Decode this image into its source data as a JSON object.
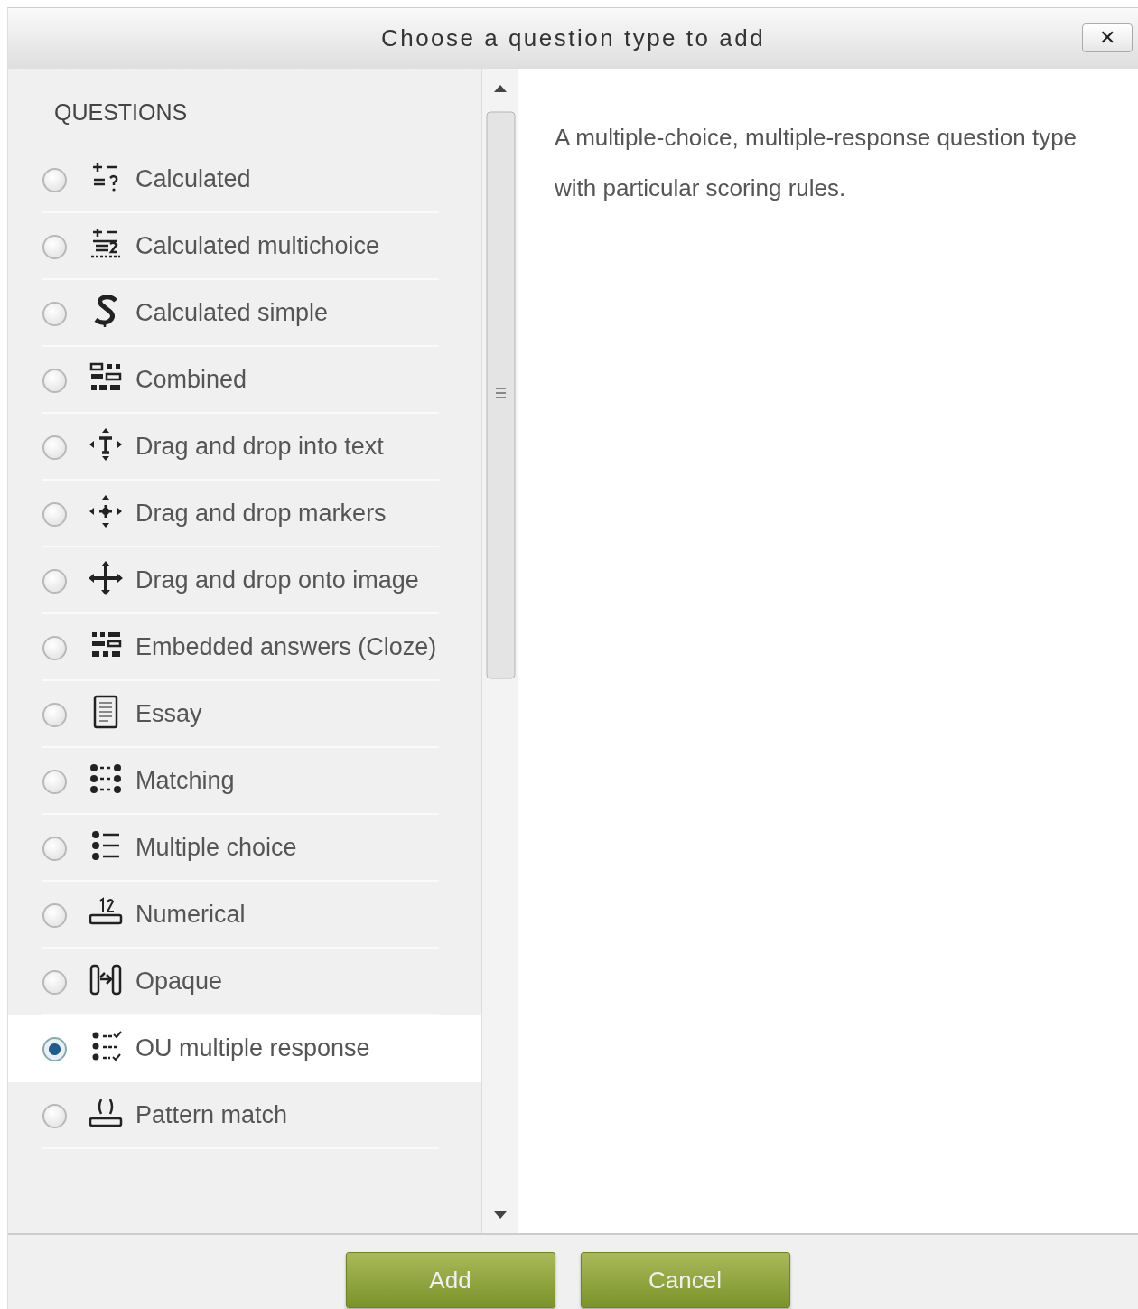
{
  "dialog": {
    "title": "Choose a question type to add",
    "close": "✕"
  },
  "questions": {
    "heading": "QUESTIONS",
    "items": [
      {
        "label": "Calculated",
        "kind": "calculated",
        "selected": false
      },
      {
        "label": "Calculated multichoice",
        "kind": "calculatedmulti",
        "selected": false
      },
      {
        "label": "Calculated simple",
        "kind": "calculatedsimple",
        "selected": false
      },
      {
        "label": "Combined",
        "kind": "combined",
        "selected": false
      },
      {
        "label": "Drag and drop into text",
        "kind": "ddwtos",
        "selected": false
      },
      {
        "label": "Drag and drop markers",
        "kind": "ddmarker",
        "selected": false
      },
      {
        "label": "Drag and drop onto image",
        "kind": "ddimage",
        "selected": false
      },
      {
        "label": "Embedded answers (Cloze)",
        "kind": "multianswer",
        "selected": false
      },
      {
        "label": "Essay",
        "kind": "essay",
        "selected": false
      },
      {
        "label": "Matching",
        "kind": "match",
        "selected": false
      },
      {
        "label": "Multiple choice",
        "kind": "multichoice",
        "selected": false
      },
      {
        "label": "Numerical",
        "kind": "numerical",
        "selected": false
      },
      {
        "label": "Opaque",
        "kind": "opaque",
        "selected": false
      },
      {
        "label": "OU multiple response",
        "kind": "oumr",
        "selected": true
      },
      {
        "label": "Pattern match",
        "kind": "pmatch",
        "selected": false
      }
    ]
  },
  "description": "A multiple-choice, multiple-response question type with particular scoring rules.",
  "buttons": [
    {
      "label": "Add"
    },
    {
      "label": "Cancel"
    }
  ]
}
